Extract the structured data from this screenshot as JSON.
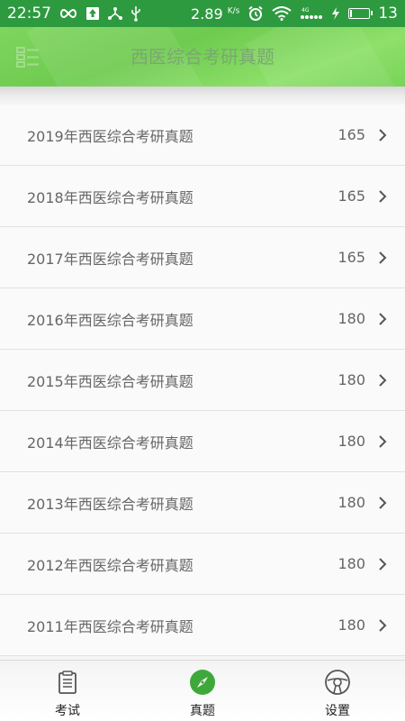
{
  "status_bar": {
    "time": "22:57",
    "speed_value": "2.89",
    "speed_unit": "K/s",
    "battery_level": "13",
    "battery_fraction": 0.13
  },
  "header": {
    "title": "西医综合考研真题",
    "menu_icon": "list-menu-icon"
  },
  "papers": [
    {
      "title": "2019年西医综合考研真题",
      "count": "165"
    },
    {
      "title": "2018年西医综合考研真题",
      "count": "165"
    },
    {
      "title": "2017年西医综合考研真题",
      "count": "165"
    },
    {
      "title": "2016年西医综合考研真题",
      "count": "180"
    },
    {
      "title": "2015年西医综合考研真题",
      "count": "180"
    },
    {
      "title": "2014年西医综合考研真题",
      "count": "180"
    },
    {
      "title": "2013年西医综合考研真题",
      "count": "180"
    },
    {
      "title": "2012年西医综合考研真题",
      "count": "180"
    },
    {
      "title": "2011年西医综合考研真题",
      "count": "180"
    }
  ],
  "tabs": [
    {
      "label": "考试",
      "icon": "exam-paper-icon",
      "active": false
    },
    {
      "label": "真题",
      "icon": "compass-icon",
      "active": true
    },
    {
      "label": "设置",
      "icon": "steering-wheel-icon",
      "active": false
    }
  ],
  "colors": {
    "status_bar": "#2e9a40",
    "header_green": "#74cf55",
    "active_tab": "#3fa83a",
    "inactive_tab": "#555555",
    "text": "#666666"
  }
}
